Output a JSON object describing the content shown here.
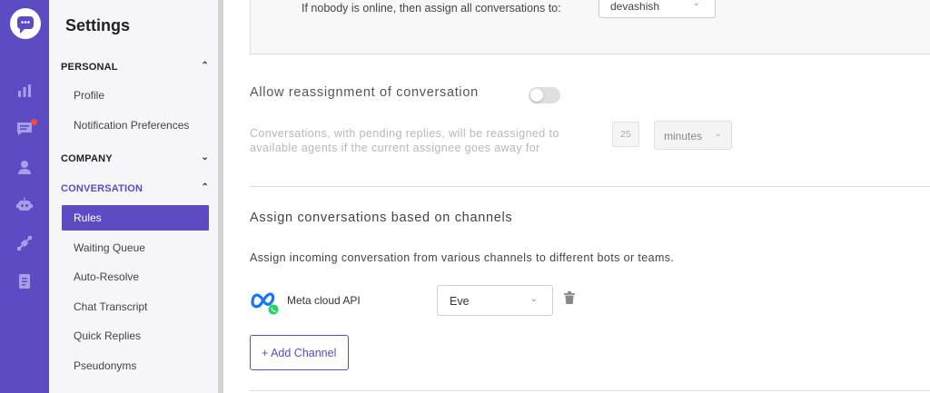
{
  "rail": {
    "icons": [
      "chat-logo-icon",
      "reports-icon",
      "conversations-icon",
      "contacts-icon",
      "bot-icon",
      "integrations-icon",
      "knowledge-base-icon"
    ],
    "accent": "#5b4cc4",
    "notification_color": "#ef4b4b"
  },
  "sidebar": {
    "title": "Settings",
    "sections": [
      {
        "label": "PERSONAL",
        "items": [
          "Profile",
          "Notification Preferences"
        ]
      },
      {
        "label": "COMPANY",
        "items": []
      },
      {
        "label": "CONVERSATION",
        "items": [
          "Rules",
          "Waiting Queue",
          "Auto-Resolve",
          "Chat Transcript",
          "Quick Replies",
          "Pseudonyms"
        ]
      }
    ],
    "active_item": "Rules"
  },
  "main": {
    "offline_rule": {
      "text": "If nobody is online, then assign all conversations to:",
      "assignee": "devashish"
    },
    "reassignment": {
      "title": "Allow reassignment of conversation",
      "enabled": false,
      "description": "Conversations, with pending replies, will be reassigned to available agents if the current assignee goes away for",
      "value": "25",
      "unit": "minutes"
    },
    "channels": {
      "title": "Assign conversations based on channels",
      "subtitle": "Assign incoming conversation from various channels to different bots or teams.",
      "rows": [
        {
          "channel": "Meta cloud API",
          "icon": "meta-whatsapp-icon",
          "assigned": "Eve"
        }
      ],
      "add_button": "+ Add Channel"
    }
  }
}
